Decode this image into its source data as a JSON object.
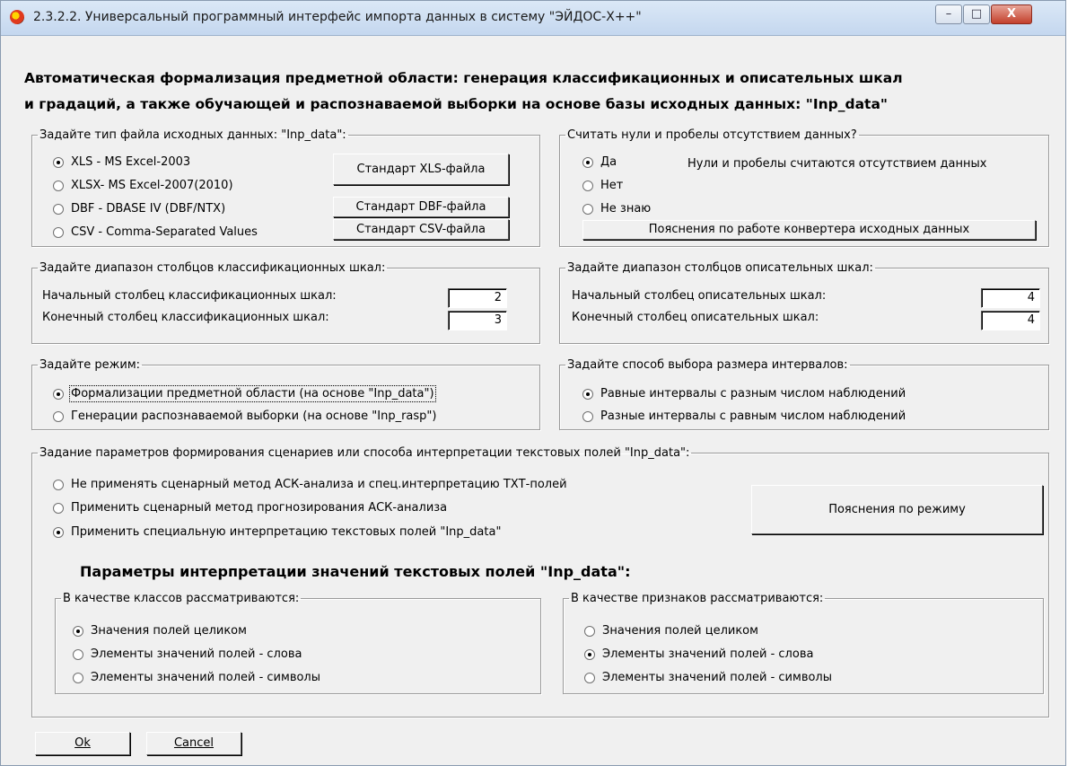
{
  "window": {
    "title": "2.3.2.2. Универсальный программный интерфейс импорта данных в систему \"ЭЙДОС-Х++\"",
    "minimize": "–",
    "maximize": "□",
    "close": "X"
  },
  "heading": {
    "line1": "Автоматическая формализация предметной области: генерация классификационных и описательных шкал",
    "line2": "и градаций,  а также обучающей и распознаваемой выборки  на  основе  базы исходных данных: \"Inp_data\""
  },
  "file_type": {
    "legend": "Задайте тип файла исходных данных: \"Inp_data\":",
    "options": [
      "XLS  - MS Excel-2003",
      "XLSX- MS Excel-2007(2010)",
      "DBF  - DBASE IV (DBF/NTX)",
      "CSV  - Comma-Separated Values"
    ],
    "selected": 0,
    "btn_xls": "Стандарт XLS-файла",
    "btn_dbf": "Стандарт DBF-файла",
    "btn_csv": "Стандарт CSV-файла"
  },
  "zeros": {
    "legend": "Считать нули и пробелы отсутствием данных?",
    "options": [
      "Да",
      "Нет",
      "Не знаю"
    ],
    "selected": 0,
    "note": "Нули и пробелы считаются отсутствием данных",
    "btn_explain": "Пояснения по работе конвертера исходных данных"
  },
  "class_range": {
    "legend": "Задайте диапазон столбцов классификационных шкал:",
    "start_label": "Начальный столбец классификационных шкал:",
    "start_value": "2",
    "end_label": "Конечный  столбец классификационных шкал:",
    "end_value": "3"
  },
  "desc_range": {
    "legend": "Задайте диапазон столбцов описательных шкал:",
    "start_label": "Начальный столбец описательных шкал:",
    "start_value": "4",
    "end_label": "Конечный  столбец описательных шкал:",
    "end_value": "4"
  },
  "mode": {
    "legend": "Задайте режим:",
    "options": [
      "Формализации предметной  области (на основе \"Inp_data\")",
      "Генерации распознаваемой выборки (на основе \"Inp_rasp\")"
    ],
    "selected": 0
  },
  "intervals": {
    "legend": "Задайте способ выбора размера интервалов:",
    "options": [
      "Равные интервалы с разным числом наблюдений",
      "Разные интервалы с равным числом наблюдений"
    ],
    "selected": 0
  },
  "scenario": {
    "legend": "Задание параметров формирования сценариев или способа интерпретации текстовых полей \"Inp_data\":",
    "options": [
      "Не применять сценарный метод АСК-анализа и спец.интерпретацию ТХТ-полей",
      "Применить сценарный метод прогнозирования АСК-анализа",
      "Применить специальную интерпретацию текстовых полей \"Inp_data\""
    ],
    "selected": 2,
    "btn_explain": "Пояснения по режиму",
    "subheading": "Параметры интерпретации значений текстовых полей \"Inp_data\":"
  },
  "classes": {
    "legend": "В качестве классов рассматриваются:",
    "options": [
      "Значения полей целиком",
      "Элементы значений полей - слова",
      "Элементы значений полей - символы"
    ],
    "selected": 0
  },
  "features": {
    "legend": "В качестве признаков рассматриваются:",
    "options": [
      "Значения полей целиком",
      "Элементы значений полей - слова",
      "Элементы значений полей - символы"
    ],
    "selected": 1
  },
  "footer": {
    "ok": "Ok",
    "cancel": "Cancel"
  }
}
